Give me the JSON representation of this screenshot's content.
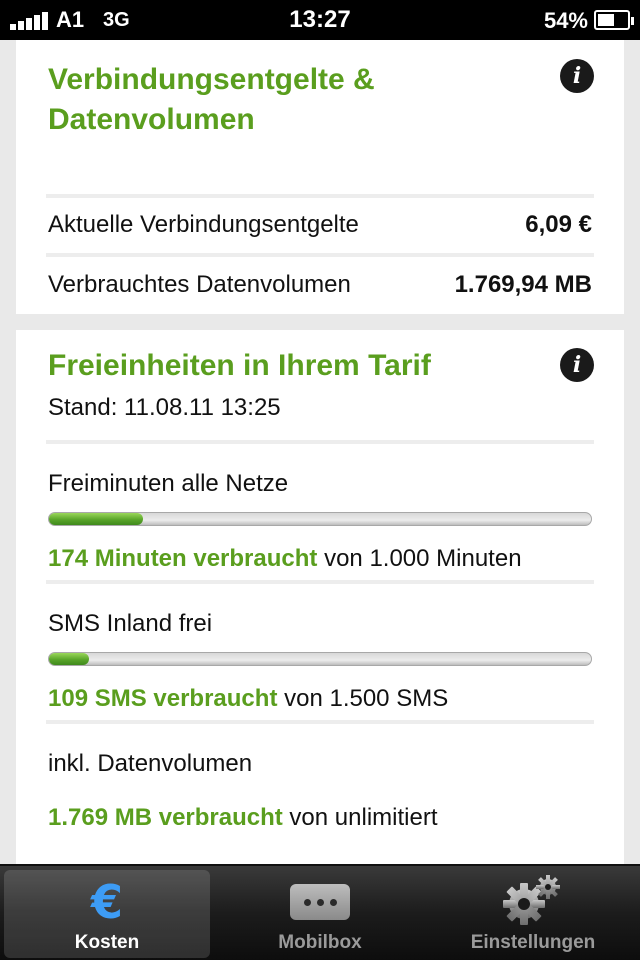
{
  "status_bar": {
    "carrier": "A1",
    "network": "3G",
    "time": "13:27",
    "battery": "54%"
  },
  "connection_card": {
    "title_line1": "Verbindungsentgelte &",
    "title_line2": "Datenvolumen",
    "rows": [
      {
        "label": "Aktuelle Verbindungsentgelte",
        "value": "6,09 €"
      },
      {
        "label": "Verbrauchtes Datenvolumen",
        "value": "1.769,94 MB"
      }
    ]
  },
  "free_units_card": {
    "title": "Freieinheiten in Ihrem Tarif",
    "stand": "Stand: 11.08.11 13:25",
    "items": [
      {
        "label": "Freiminuten alle Netze",
        "used": "174 Minuten verbraucht",
        "total": " von 1.000 Minuten",
        "fraction": 0.174
      },
      {
        "label": "SMS Inland frei",
        "used": "109 SMS verbraucht",
        "total": " von 1.500 SMS",
        "fraction": 0.073
      },
      {
        "label": "inkl. Datenvolumen",
        "used": "1.769 MB verbraucht",
        "total": " von unlimitiert"
      }
    ]
  },
  "tab_bar": {
    "tabs": [
      {
        "label": "Kosten",
        "icon": "euro-icon",
        "active": true
      },
      {
        "label": "Mobilbox",
        "icon": "voicemail-icon",
        "active": false
      },
      {
        "label": "Einstellungen",
        "icon": "gear-icon",
        "active": false
      }
    ]
  },
  "colors": {
    "accent_green": "#5a9e1e",
    "euro_blue": "#3d9cf5"
  }
}
